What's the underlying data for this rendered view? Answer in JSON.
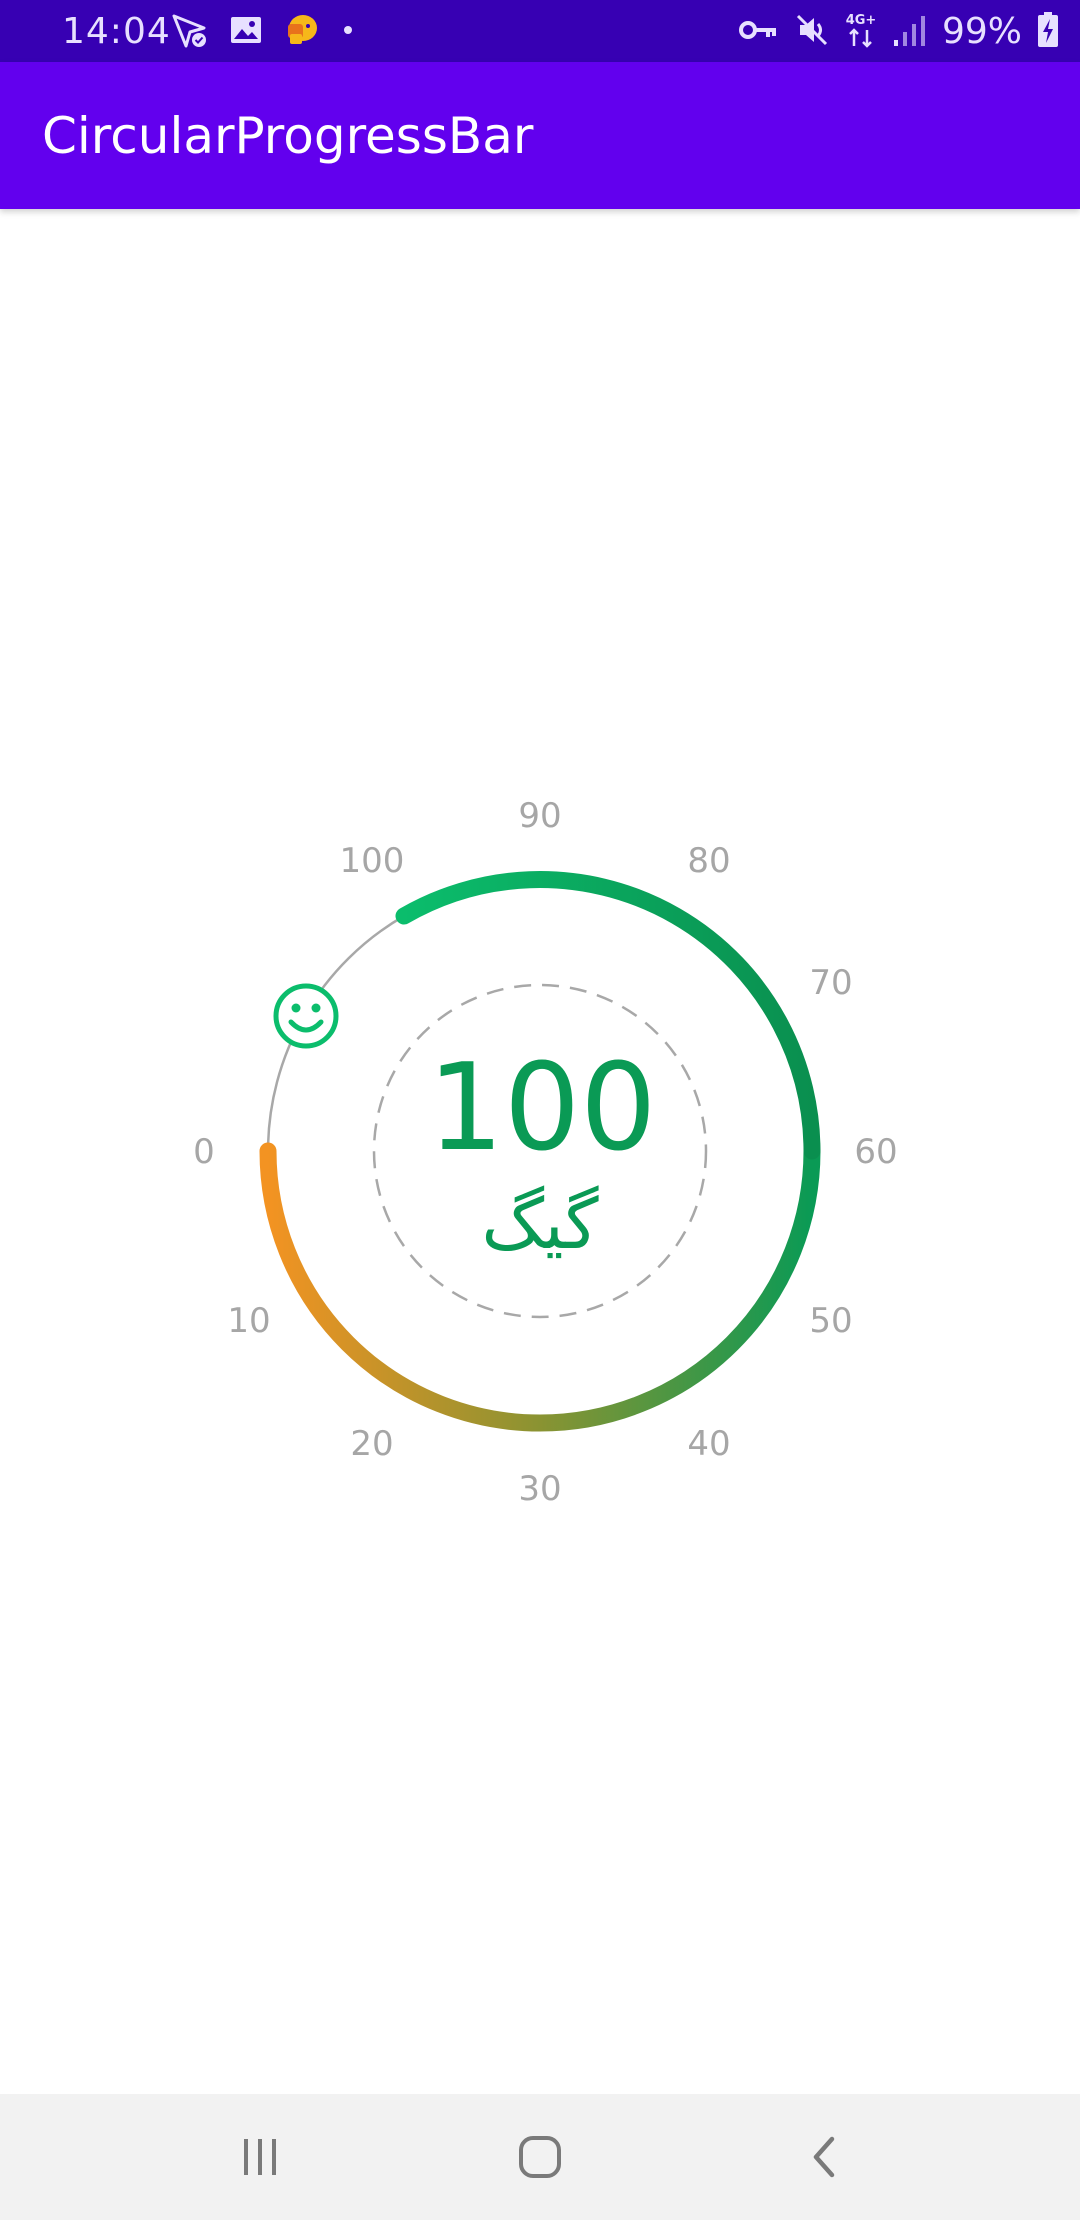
{
  "status_bar": {
    "time": "14:04",
    "battery_percent": "99%",
    "network_label": "4G+",
    "left_icons": [
      "navigation-check-icon",
      "gallery-icon",
      "app-notification-icon",
      "dot-icon"
    ],
    "right_icons": [
      "vpn-key-icon",
      "mute-icon",
      "network-icon",
      "signal-icon",
      "battery-charging-icon"
    ]
  },
  "app_bar": {
    "title": "CircularProgressBar"
  },
  "progress": {
    "value": "100",
    "unit": "گیگ",
    "ticks": [
      "0",
      "10",
      "20",
      "30",
      "40",
      "50",
      "60",
      "70",
      "80",
      "90",
      "100"
    ],
    "range": [
      0,
      100
    ],
    "indicator_icon": "smiley-icon",
    "colors": {
      "start": "#f39322",
      "middle": "#8a9332",
      "end": "#0a9a55",
      "top": "#0bbd6c",
      "track": "#a8a8a8",
      "text": "#0a9a55",
      "tick": "#a6a6a6"
    }
  },
  "nav_bar": {
    "buttons": [
      "recent-apps-icon",
      "home-icon",
      "back-icon"
    ]
  },
  "colors": {
    "status_bar": "#3700b3",
    "app_bar": "#6200ee",
    "nav_bar": "#f2f2f2"
  }
}
